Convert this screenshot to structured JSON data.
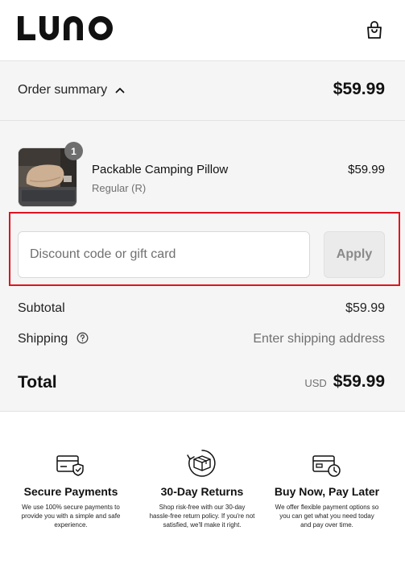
{
  "header": {
    "logo_text": "LUNO",
    "cart_icon": "shopping-bag-icon"
  },
  "summary": {
    "toggle_label": "Order summary",
    "toggle_icon": "chevron-up-icon",
    "total": "$59.99"
  },
  "item": {
    "quantity": "1",
    "name": "Packable Camping Pillow",
    "variant": "Regular (R)",
    "price": "$59.99"
  },
  "discount": {
    "placeholder": "Discount code or gift card",
    "apply_label": "Apply"
  },
  "totals": {
    "subtotal_label": "Subtotal",
    "subtotal_value": "$59.99",
    "shipping_label": "Shipping",
    "shipping_value": "Enter shipping address",
    "total_label": "Total",
    "currency": "USD",
    "total_value": "$59.99"
  },
  "trust": [
    {
      "icon": "credit-card-shield-icon",
      "title": "Secure Payments",
      "text": "We use 100% secure payments to provide you with a simple and safe experience."
    },
    {
      "icon": "box-return-icon",
      "title": "30-Day Returns",
      "text": "Shop risk-free with our 30-day hassle-free return policy. If you're not satisfied, we'll make it right."
    },
    {
      "icon": "card-clock-icon",
      "title": "Buy Now, Pay Later",
      "text": "We offer flexible payment options so you can get what you need today and pay over time."
    }
  ],
  "colors": {
    "highlight": "#e0141e",
    "summary_background": "#f5f5f5",
    "badge": "#6e6e6e"
  }
}
